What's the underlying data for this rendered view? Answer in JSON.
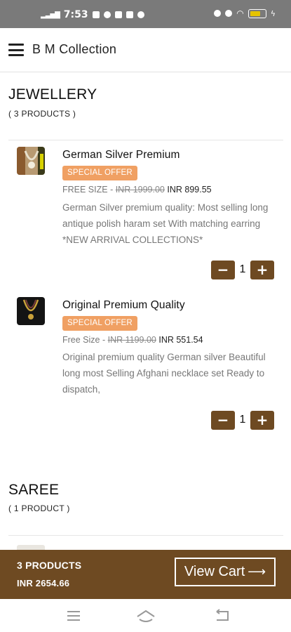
{
  "status_bar": {
    "time": "7:53",
    "battery": "84"
  },
  "header": {
    "title": "B M Collection"
  },
  "sections": [
    {
      "title": "JEWELLERY",
      "count": "( 3 PRODUCTS )",
      "products": [
        {
          "name": "German Silver Premium",
          "badge": "SPECIAL OFFER",
          "size_prefix": "FREE SIZE - ",
          "old_price": "INR 1999.00",
          "new_price": " INR 899.55",
          "description": "German Silver premium quality: Most selling long antique polish haram set With matching earring *NEW ARRIVAL COLLECTIONS*",
          "quantity": "1",
          "minus": "−",
          "plus": "+"
        },
        {
          "name": "Original Premium Quality",
          "badge": "SPECIAL OFFER",
          "size_prefix": "Free Size - ",
          "old_price": "INR 1199.00",
          "new_price": " INR 551.54",
          "description": "Original premium quality German silver Beautiful long most Selling Afghani necklace set Ready to dispatch,",
          "quantity": "1",
          "minus": "−",
          "plus": "+"
        }
      ]
    },
    {
      "title": "SAREE",
      "count": "( 1 PRODUCT )"
    }
  ],
  "cart": {
    "count": "3 PRODUCTS",
    "total": "INR 2654.66",
    "button": "View Cart",
    "arrow": "⟶"
  },
  "colors": {
    "brand": "#6e4a22",
    "badge": "#f0a063"
  },
  "icons": [
    "menu-icon",
    "minus-icon",
    "plus-icon",
    "arrow-right-icon",
    "recents-icon",
    "home-icon",
    "back-icon"
  ]
}
